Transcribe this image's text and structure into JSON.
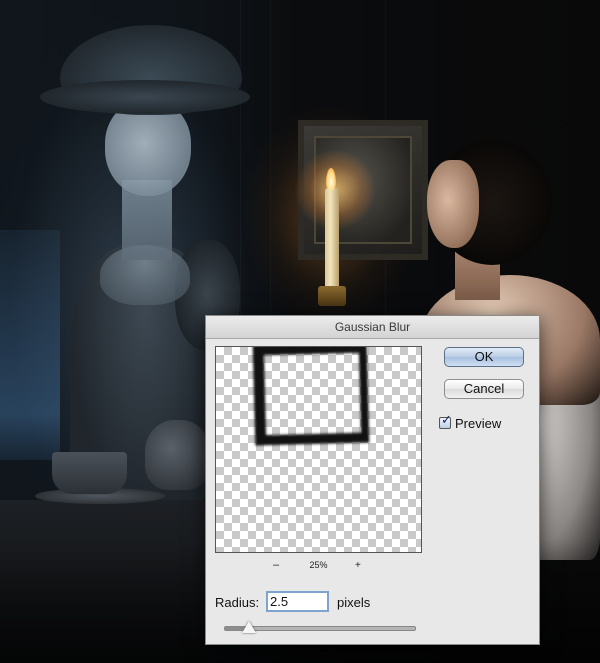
{
  "dialog": {
    "title": "Gaussian Blur",
    "ok_label": "OK",
    "cancel_label": "Cancel",
    "preview_label": "Preview",
    "preview_checked": true,
    "zoom_minus": "–",
    "zoom_level": "25%",
    "zoom_plus": "+",
    "radius_label": "Radius:",
    "radius_value": "2.5",
    "radius_unit": "pixels",
    "radius_slider_fraction": 0.13
  }
}
